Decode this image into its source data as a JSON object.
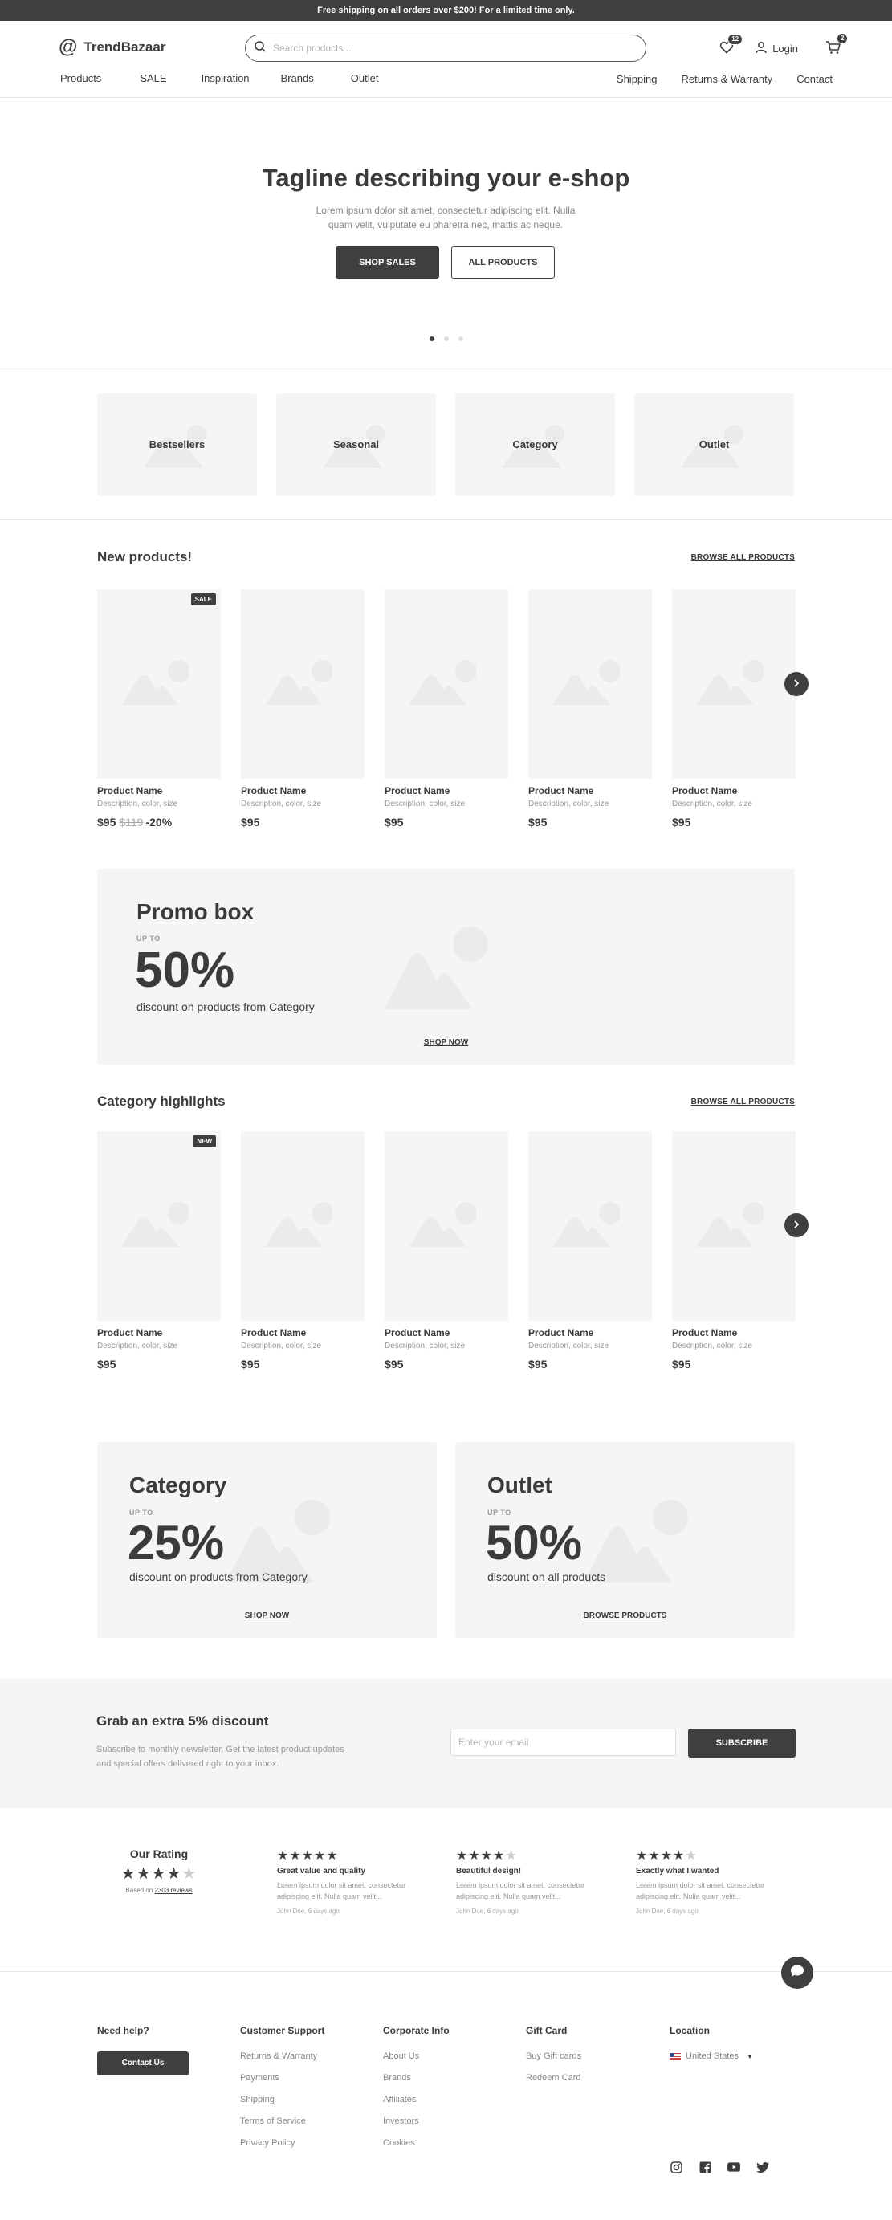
{
  "announcement": "Free shipping on all orders over $200! For a limited time only.",
  "header": {
    "logo_text": "TrendBazaar",
    "search_placeholder": "Search products...",
    "wishlist_count": "12",
    "login_label": "Login",
    "cart_count": "2"
  },
  "nav": {
    "left": [
      "Products",
      "SALE",
      "Inspiration",
      "Brands",
      "Outlet"
    ],
    "right": [
      "Shipping",
      "Returns & Warranty",
      "Contact"
    ]
  },
  "hero": {
    "title": "Tagline describing your e-shop",
    "subtitle": "Lorem ipsum dolor sit amet, consectetur adipiscing elit. Nulla quam velit, vulputate eu pharetra nec, mattis ac neque.",
    "primary_cta": "SHOP SALES",
    "secondary_cta": "ALL PRODUCTS",
    "slides": 3,
    "active_slide": 1
  },
  "categories": [
    "Bestsellers",
    "Seasonal",
    "Category",
    "Outlet"
  ],
  "new_products": {
    "title": "New products!",
    "link": "BROWSE ALL PRODUCTS",
    "items": [
      {
        "tag": "SALE",
        "name": "Product Name",
        "desc": "Description, color, size",
        "price": "$95",
        "old_price": "$119",
        "discount": "-20%"
      },
      {
        "tag": "",
        "name": "Product Name",
        "desc": "Description, color, size",
        "price": "$95",
        "old_price": "",
        "discount": ""
      },
      {
        "tag": "",
        "name": "Product Name",
        "desc": "Description, color, size",
        "price": "$95",
        "old_price": "",
        "discount": ""
      },
      {
        "tag": "",
        "name": "Product Name",
        "desc": "Description, color, size",
        "price": "$95",
        "old_price": "",
        "discount": ""
      },
      {
        "tag": "",
        "name": "Product Name",
        "desc": "Description, color, size",
        "price": "$95",
        "old_price": "",
        "discount": ""
      }
    ]
  },
  "promo": {
    "title": "Promo box",
    "upto": "UP TO",
    "percent": "50%",
    "subtitle": "discount on products from Category",
    "cta": "SHOP NOW"
  },
  "category_highlights": {
    "title": "Category highlights",
    "link": "BROWSE ALL PRODUCTS",
    "items": [
      {
        "tag": "NEW",
        "name": "Product Name",
        "desc": "Description, color, size",
        "price": "$95"
      },
      {
        "tag": "",
        "name": "Product Name",
        "desc": "Description, color, size",
        "price": "$95"
      },
      {
        "tag": "",
        "name": "Product Name",
        "desc": "Description, color, size",
        "price": "$95"
      },
      {
        "tag": "",
        "name": "Product Name",
        "desc": "Description, color, size",
        "price": "$95"
      },
      {
        "tag": "",
        "name": "Product Name",
        "desc": "Description, color, size",
        "price": "$95"
      }
    ]
  },
  "dual_promo": [
    {
      "title": "Category",
      "upto": "UP TO",
      "percent": "25%",
      "subtitle": "discount on products from Category",
      "cta": "SHOP NOW"
    },
    {
      "title": "Outlet",
      "upto": "UP TO",
      "percent": "50%",
      "subtitle": "discount on all products",
      "cta": "BROWSE PRODUCTS"
    }
  ],
  "newsletter": {
    "title": "Grab an extra 5% discount",
    "text": "Subscribe to monthly newsletter. Get the latest product updates and special offers delivered right to your inbox.",
    "placeholder": "Enter your email",
    "button": "SUBSCRIBE"
  },
  "rating": {
    "title": "Our Rating",
    "stars": 4,
    "based_prefix": "Based on",
    "based_link": "2303 reviews"
  },
  "reviews": [
    {
      "stars": 5,
      "title": "Great value and quality",
      "body": "Lorem ipsum dolor sit amet, consectetur adipiscing elit. Nulla quam velit...",
      "by": "John Doe, 6 days ago"
    },
    {
      "stars": 4,
      "title": "Beautiful design!",
      "body": "Lorem ipsum dolor sit amet, consectetur adipiscing elit. Nulla quam velit...",
      "by": "John Doe, 6 days ago"
    },
    {
      "stars": 4,
      "title": "Exactly what I wanted",
      "body": "Lorem ipsum dolor sit amet, consectetur adipiscing elit. Nulla quam velit...",
      "by": "John Doe, 6 days ago"
    }
  ],
  "footer": {
    "help_title": "Need help?",
    "contact_button": "Contact Us",
    "customer_support": {
      "title": "Customer Support",
      "links": [
        "Returns & Warranty",
        "Payments",
        "Shipping",
        "Terms of Service",
        "Privacy Policy"
      ]
    },
    "corporate": {
      "title": "Corporate Info",
      "links": [
        "About Us",
        "Brands",
        "Affiliates",
        "Investors",
        "Cookies"
      ]
    },
    "gift_card": {
      "title": "Gift Card",
      "links": [
        "Buy Gift cards",
        "Redeem Card"
      ]
    },
    "location": {
      "title": "Location",
      "country": "United States"
    },
    "socials": [
      "instagram-icon",
      "facebook-icon",
      "youtube-icon",
      "twitter-icon"
    ]
  },
  "colors": {
    "accent": "#3f3f3f",
    "panel": "#f5f5f5",
    "muted": "#999999"
  }
}
